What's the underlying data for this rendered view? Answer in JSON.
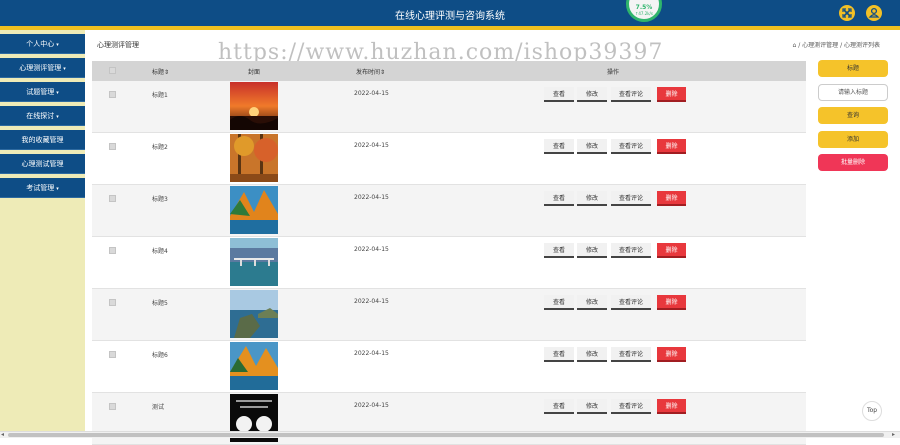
{
  "header": {
    "title": "在线心理评测与咨询系统",
    "badge_value": "7.5%",
    "badge_sub": "↑47.2k/s",
    "icons": [
      "expand-icon",
      "user-icon"
    ]
  },
  "sidebar": {
    "items": [
      {
        "label": "个人中心",
        "has_caret": true
      },
      {
        "label": "心理测评管理",
        "has_caret": true
      },
      {
        "label": "试题管理",
        "has_caret": true
      },
      {
        "label": "在线探讨",
        "has_caret": true
      },
      {
        "label": "我的收藏管理",
        "has_caret": false
      },
      {
        "label": "心理测试管理",
        "has_caret": false
      },
      {
        "label": "考试管理",
        "has_caret": true
      }
    ]
  },
  "page": {
    "title": "心理测评管理",
    "breadcrumb": "心理测评管理 / 心理测评列表",
    "watermark": "https://www.huzhan.com/ishop39397"
  },
  "table": {
    "columns": {
      "title": "标题",
      "cover": "封面",
      "date": "发布时间",
      "ops": "操作"
    },
    "rows": [
      {
        "title": "标题1",
        "date": "2022-04-15",
        "thumb": "sunset"
      },
      {
        "title": "标题2",
        "date": "2022-04-15",
        "thumb": "autumn-forest"
      },
      {
        "title": "标题3",
        "date": "2022-04-15",
        "thumb": "autumn-lake"
      },
      {
        "title": "标题4",
        "date": "2022-04-15",
        "thumb": "bridge-lake"
      },
      {
        "title": "标题5",
        "date": "2022-04-15",
        "thumb": "coast"
      },
      {
        "title": "标题6",
        "date": "2022-04-15",
        "thumb": "autumn-lake-2"
      },
      {
        "title": "测试",
        "date": "2022-04-15",
        "thumb": "dark-text"
      }
    ],
    "ops": {
      "view": "查看",
      "edit": "修改",
      "comments": "查看评论",
      "delete": "删除"
    }
  },
  "side": {
    "title_button": "标题",
    "search_placeholder": "请输入标题",
    "query_button": "查询",
    "add_button": "添加",
    "batch_delete_button": "批量删除"
  },
  "misc": {
    "top_button": "Top"
  },
  "colors": {
    "primary": "#0e4d86",
    "accent": "#f5c32a",
    "danger": "#e8383d",
    "sidebar_bg": "#eeebb7"
  }
}
